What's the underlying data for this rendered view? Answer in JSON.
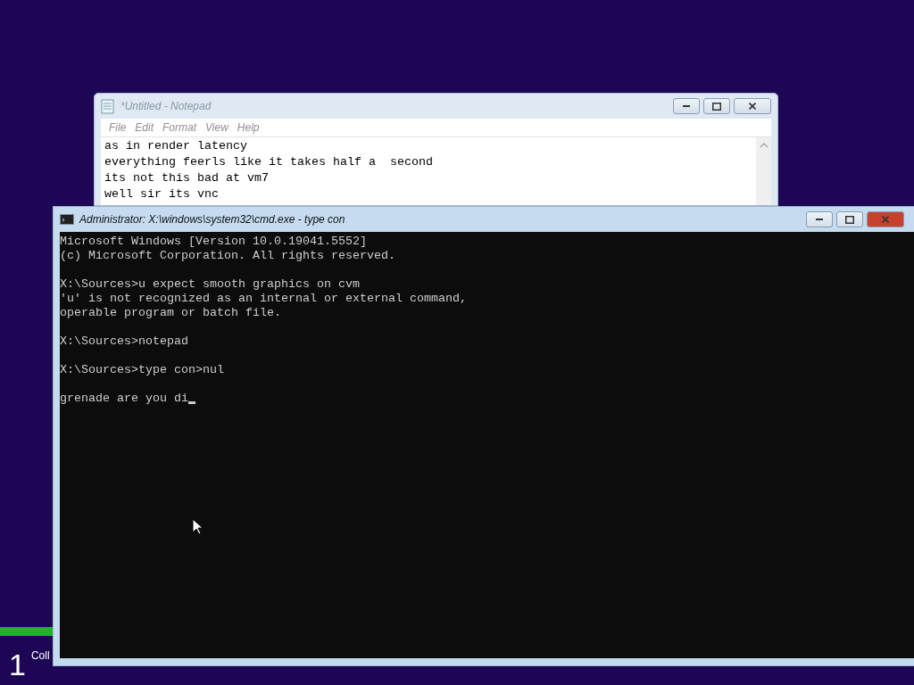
{
  "setup_steps": {
    "steps": [
      {
        "number": "1",
        "label": "Coll",
        "selected": true
      }
    ]
  },
  "notepad": {
    "title": "*Untitled - Notepad",
    "active": false,
    "menu": [
      "File",
      "Edit",
      "Format",
      "View",
      "Help"
    ],
    "lines": [
      "as in render latency",
      "everything feerls like it takes half a  second",
      "its not this bad at vm7",
      "well sir its vnc"
    ]
  },
  "console": {
    "title": "Administrator: X:\\windows\\system32\\cmd.exe - type  con",
    "active": true,
    "caret": true,
    "blocks": [
      [
        "Microsoft Windows [Version 10.0.19041.5552]",
        "(c) Microsoft Corporation. All rights reserved."
      ],
      [
        "X:\\Sources>u expect smooth graphics on cvm",
        "'u' is not recognized as an internal or external command,",
        "operable program or batch file."
      ],
      [
        "X:\\Sources>notepad"
      ],
      [
        "X:\\Sources>type con>nul"
      ],
      [
        "grenade are you di"
      ]
    ]
  }
}
